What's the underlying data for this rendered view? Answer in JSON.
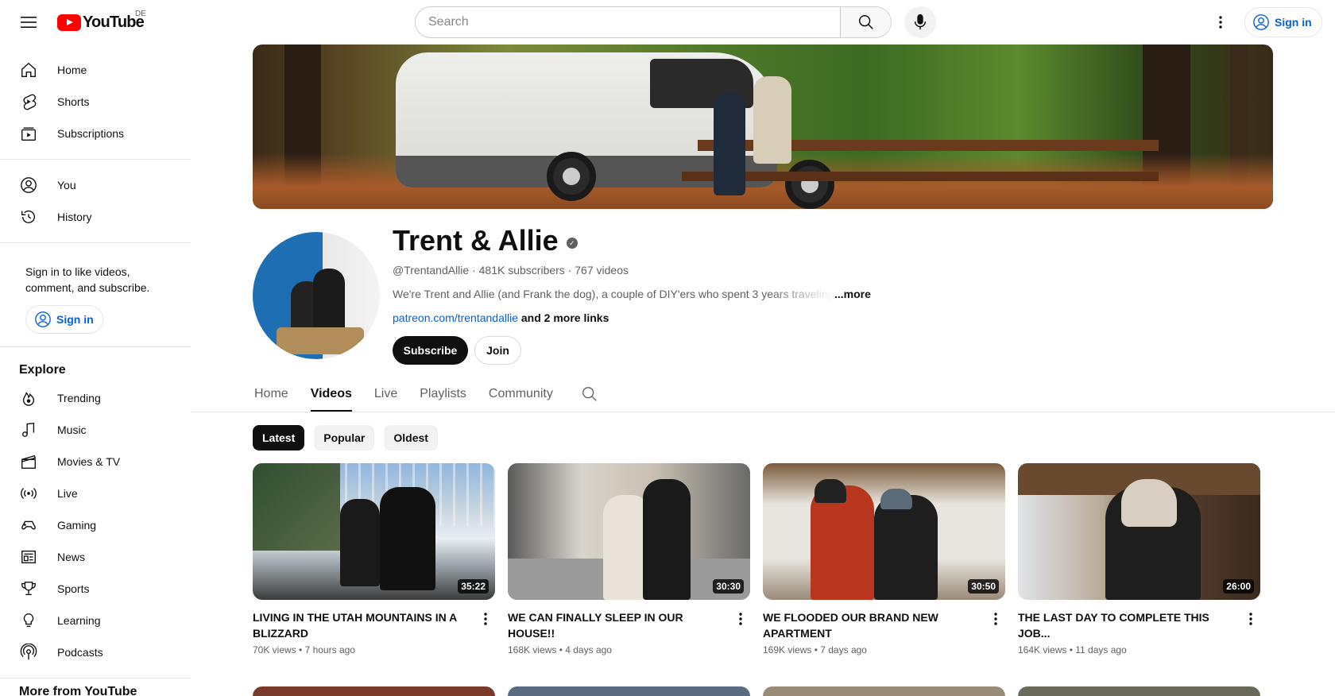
{
  "header": {
    "logo_text": "YouTube",
    "country_code": "DE",
    "search_placeholder": "Search",
    "signin_label": "Sign in"
  },
  "sidebar": {
    "main_items": [
      {
        "label": "Home",
        "icon": "home-icon"
      },
      {
        "label": "Shorts",
        "icon": "shorts-icon"
      },
      {
        "label": "Subscriptions",
        "icon": "subscriptions-icon"
      }
    ],
    "you_items": [
      {
        "label": "You",
        "icon": "account-icon"
      },
      {
        "label": "History",
        "icon": "history-icon"
      }
    ],
    "signin_prompt": "Sign in to like videos, comment, and subscribe.",
    "signin_label": "Sign in",
    "explore_heading": "Explore",
    "explore_items": [
      {
        "label": "Trending",
        "icon": "trending-icon"
      },
      {
        "label": "Music",
        "icon": "music-icon"
      },
      {
        "label": "Movies & TV",
        "icon": "movies-icon"
      },
      {
        "label": "Live",
        "icon": "live-icon"
      },
      {
        "label": "Gaming",
        "icon": "gaming-icon"
      },
      {
        "label": "News",
        "icon": "news-icon"
      },
      {
        "label": "Sports",
        "icon": "sports-icon"
      },
      {
        "label": "Learning",
        "icon": "learning-icon"
      },
      {
        "label": "Podcasts",
        "icon": "podcasts-icon"
      }
    ],
    "more_heading": "More from YouTube"
  },
  "channel": {
    "name": "Trent & Allie",
    "handle": "@TrentandAllie",
    "subscribers": "481K subscribers",
    "videos": "767 videos",
    "description": "We're Trent and Allie (and Frank the dog), a couple of DIY'ers who spent 3 years traveling",
    "more_label": "...more",
    "link": "patreon.com/trentandallie",
    "more_links": "and 2 more links",
    "subscribe_label": "Subscribe",
    "join_label": "Join"
  },
  "tabs": [
    "Home",
    "Videos",
    "Live",
    "Playlists",
    "Community"
  ],
  "active_tab": "Videos",
  "chips": [
    "Latest",
    "Popular",
    "Oldest"
  ],
  "active_chip": "Latest",
  "videos": [
    {
      "title": "LIVING IN THE UTAH MOUNTAINS IN A BLIZZARD",
      "views": "70K views",
      "age": "7 hours ago",
      "duration": "35:22"
    },
    {
      "title": "WE CAN FINALLY SLEEP IN OUR HOUSE!!",
      "views": "168K views",
      "age": "4 days ago",
      "duration": "30:30"
    },
    {
      "title": "WE FLOODED OUR BRAND NEW APARTMENT",
      "views": "169K views",
      "age": "7 days ago",
      "duration": "30:50"
    },
    {
      "title": "THE LAST DAY TO COMPLETE THIS JOB...",
      "views": "164K views",
      "age": "11 days ago",
      "duration": "26:00"
    }
  ],
  "colors": {
    "brand_red": "#ff0000",
    "link_blue": "#065fd4",
    "text_primary": "#0f0f0f",
    "text_secondary": "#606060"
  }
}
